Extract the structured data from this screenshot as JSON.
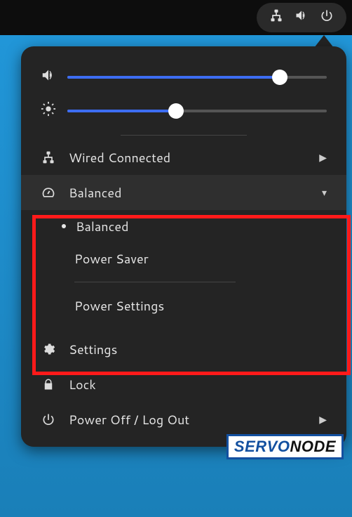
{
  "tray": {
    "icons": [
      "network-wired-icon",
      "volume-high-icon",
      "power-icon"
    ]
  },
  "sliders": {
    "volume": {
      "percent": 82
    },
    "brightness": {
      "percent": 42
    }
  },
  "menu": {
    "wired": {
      "label": "Wired Connected"
    },
    "power_profile": {
      "label": "Balanced",
      "options": {
        "balanced": "Balanced",
        "saver": "Power Saver"
      },
      "settings_label": "Power Settings",
      "selected": "balanced"
    },
    "settings": {
      "label": "Settings"
    },
    "lock": {
      "label": "Lock"
    },
    "power_off": {
      "label": "Power Off / Log Out"
    }
  },
  "watermark": {
    "part1": "SERVO",
    "part2": "NODE"
  }
}
